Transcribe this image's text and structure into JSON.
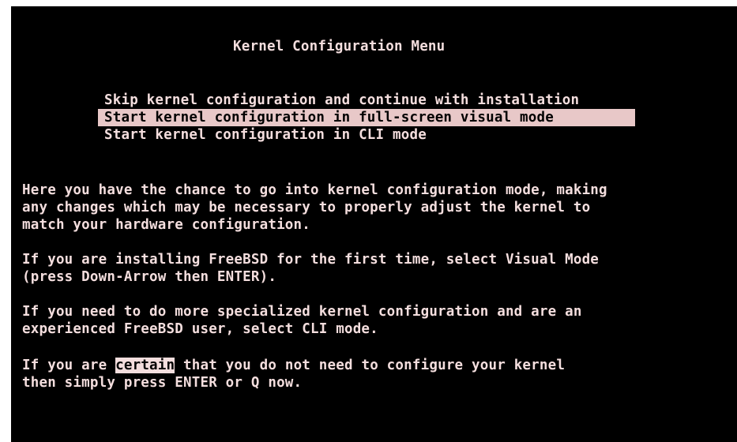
{
  "screen": {
    "title": "Kernel Configuration Menu",
    "menu": {
      "items": [
        {
          "label": "Skip kernel configuration and continue with installation",
          "selected": false
        },
        {
          "label": "Start kernel configuration in full-screen visual mode",
          "selected": true
        },
        {
          "label": "Start kernel configuration in CLI mode",
          "selected": false
        }
      ]
    },
    "help": {
      "p1": [
        "Here you have the chance to go into kernel configuration mode, making",
        "any changes which may be necessary to properly adjust the kernel to",
        "match your hardware configuration."
      ],
      "p2": [
        "If you are installing FreeBSD for the first time, select Visual Mode",
        "(press Down-Arrow then ENTER)."
      ],
      "p3": [
        "If you need to do more specialized kernel configuration and are an",
        "experienced FreeBSD user, select CLI mode."
      ],
      "p4": {
        "line1_prefix": "If you are ",
        "line1_highlight": "certain",
        "line1_suffix": " that you do not need to configure your kernel",
        "line2": "then simply press ENTER or Q now."
      }
    },
    "colors": {
      "background": "#000000",
      "foreground": "#f4dede",
      "selection_bg": "#e8c8c8",
      "selection_fg": "#000000"
    }
  }
}
